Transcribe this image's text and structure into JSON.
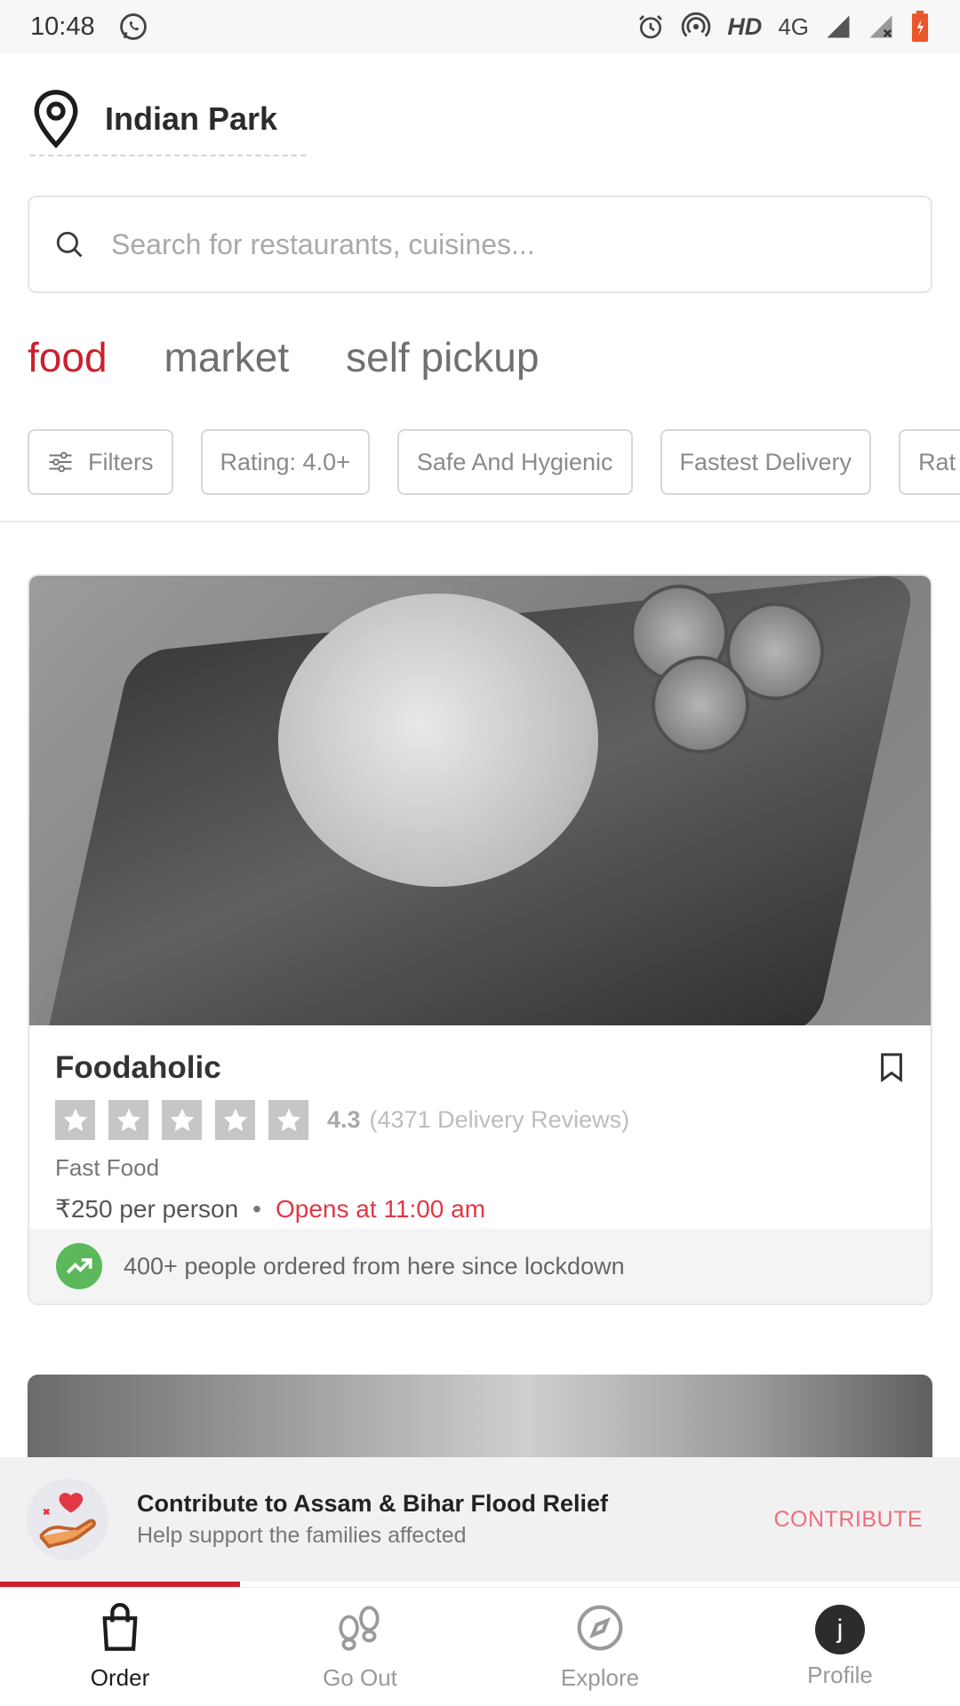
{
  "status_bar": {
    "time": "10:48",
    "network_label": "HD",
    "network_type": "4G",
    "icons": [
      "whatsapp-icon",
      "alarm-icon",
      "hotspot-icon",
      "signal-icon",
      "signal-x-icon",
      "battery-icon"
    ]
  },
  "location": {
    "name": "Indian Park"
  },
  "search": {
    "placeholder": "Search for restaurants, cuisines..."
  },
  "tabs": [
    {
      "label": "food",
      "active": true
    },
    {
      "label": "market",
      "active": false
    },
    {
      "label": "self pickup",
      "active": false
    }
  ],
  "filters": [
    {
      "label": "Filters",
      "icon": "sliders-icon"
    },
    {
      "label": "Rating: 4.0+"
    },
    {
      "label": "Safe And Hygienic"
    },
    {
      "label": "Fastest Delivery"
    },
    {
      "label": "Rat"
    }
  ],
  "restaurant": {
    "name": "Foodaholic",
    "rating": "4.3",
    "stars": 5,
    "reviews": "(4371 Delivery Reviews)",
    "cuisine": "Fast Food",
    "price": "₹250 per person",
    "separator": "•",
    "status": "Opens at 11:00 am",
    "footer_text": "400+ people ordered from here since lockdown"
  },
  "banner": {
    "title": "Contribute to Assam & Bihar Flood Relief",
    "subtitle": "Help support the families affected",
    "cta": "CONTRIBUTE"
  },
  "bottom_nav": [
    {
      "label": "Order",
      "icon": "bag-icon",
      "active": true
    },
    {
      "label": "Go Out",
      "icon": "footprints-icon",
      "active": false
    },
    {
      "label": "Explore",
      "icon": "compass-icon",
      "active": false
    },
    {
      "label": "Profile",
      "icon": "avatar",
      "avatar_letter": "j",
      "active": false
    }
  ],
  "colors": {
    "accent": "#cb202d",
    "open_status": "#e23744",
    "cta": "#f06d7a",
    "trend_green": "#5bb85b"
  }
}
